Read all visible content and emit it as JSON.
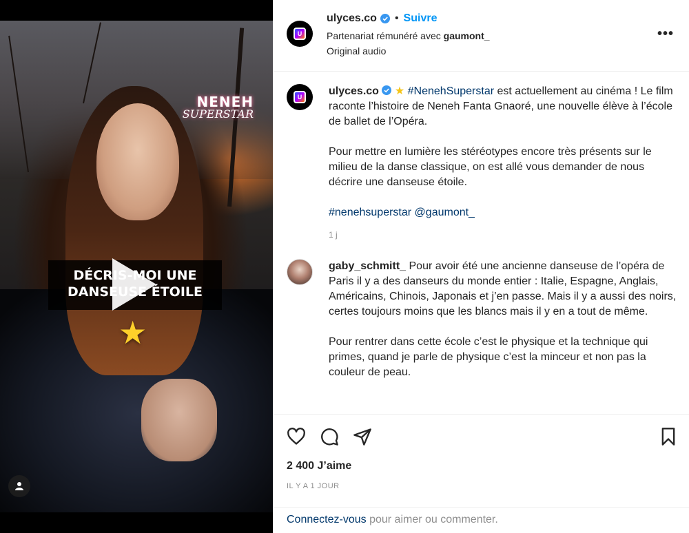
{
  "post": {
    "author": "ulyces.co",
    "follow_label": "Suivre",
    "partnership_prefix": "Partenariat rémunéré avec",
    "partner": "gaumont_",
    "audio": "Original audio",
    "more_icon": "more-options-icon"
  },
  "video": {
    "overlay_logo_line1": "NENEH",
    "overlay_logo_line2": "SUPERSTAR",
    "caption_line1": "DÉCRIS-MOI UNE",
    "caption_line2": "DANSEUSE ÉTOILE",
    "star_glyph": "★"
  },
  "caption": {
    "author": "ulyces.co",
    "star_glyph": "★",
    "hashtag_main": "#NenehSuperstar",
    "text1": " est actuellement au cinéma ! Le film raconte l’histoire de Neneh Fanta Gnaoré, une nouvelle élève à l’école de ballet de l’Opéra.",
    "text2": "Pour mettre en lumière les stéréotypes encore très présents sur le milieu de la danse classique, on est allé vous demander de nous décrire une danseuse étoile.",
    "hashtag2": "#nenehsuperstar",
    "mention": "@gaumont_",
    "time": "1 j"
  },
  "comment": {
    "author": "gaby_schmitt_",
    "text1": " Pour avoir été une ancienne danseuse de l’opéra de Paris il y a des danseurs du monde entier : Italie, Espagne, Anglais, Américains, Chinois, Japonais et j’en passe. Mais il y a aussi des noirs, certes toujours moins que les blancs mais il y en a tout de même.",
    "text2": "Pour rentrer dans cette école c’est le physique et la technique qui primes, quand je parle de physique c’est la minceur et non pas la couleur de peau."
  },
  "stats": {
    "likes": "2 400 J’aime",
    "date": "IL Y A 1 JOUR"
  },
  "footer": {
    "login": "Connectez-vous",
    "rest": " pour aimer ou commenter."
  },
  "colors": {
    "link_blue": "#0095f6",
    "hashtag": "#00376b",
    "muted": "#8e8e8e",
    "verified": "#3897f0"
  }
}
